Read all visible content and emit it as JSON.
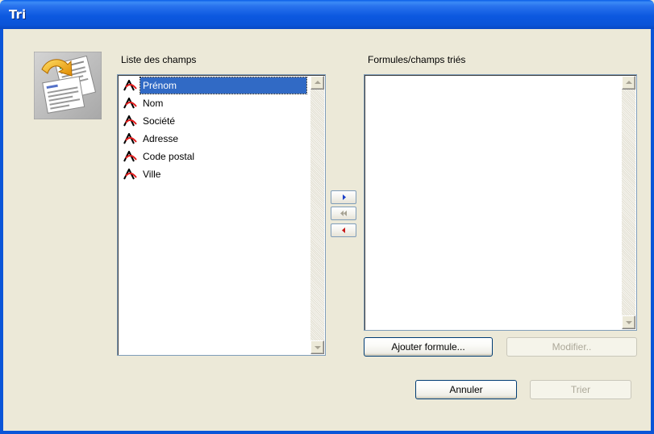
{
  "window": {
    "title": "Tri"
  },
  "fields": {
    "label": "Liste des champs",
    "items": [
      {
        "label": "Prénom",
        "selected": true,
        "icon": "text-field-icon"
      },
      {
        "label": "Nom",
        "selected": false,
        "icon": "text-field-icon"
      },
      {
        "label": "Société",
        "selected": false,
        "icon": "text-field-icon"
      },
      {
        "label": "Adresse",
        "selected": false,
        "icon": "text-field-icon"
      },
      {
        "label": "Code postal",
        "selected": false,
        "icon": "text-field-icon"
      },
      {
        "label": "Ville",
        "selected": false,
        "icon": "text-field-icon"
      }
    ]
  },
  "sorted": {
    "label": "Formules/champs triés",
    "items": []
  },
  "transfer_buttons": [
    {
      "icon": "arrow-right-icon",
      "color": "#1b3fc9"
    },
    {
      "icon": "double-arrow-left-icon",
      "color": "#a7a394"
    },
    {
      "icon": "arrow-left-icon",
      "color": "#c81818"
    }
  ],
  "buttons": {
    "add_formula": "Ajouter formule...",
    "modify": "Modifier..",
    "cancel": "Annuler",
    "sort": "Trier"
  },
  "colors": {
    "titlebar": "#0a54d8",
    "selection": "#316ac5",
    "dialog_bg": "#ece9d8"
  }
}
